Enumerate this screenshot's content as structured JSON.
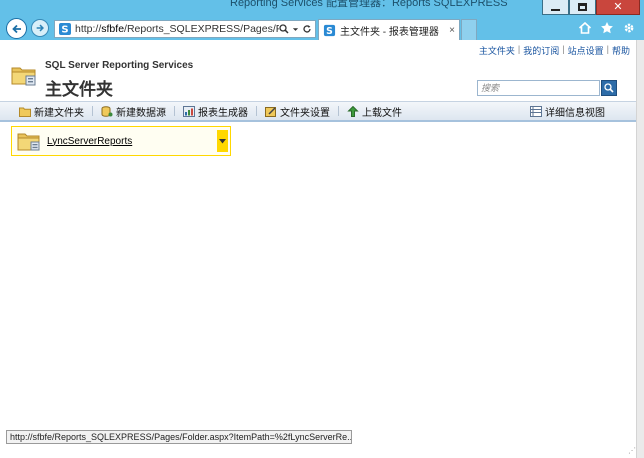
{
  "browser": {
    "window_title_fragment": "Reporting Services 配置管理器：Reports SQLEXPRESS",
    "address": {
      "url_prefix": "http://",
      "url_host": "sfbfe",
      "url_rest": "/Reports_SQLEXPRESS/Pages/Folder.asp"
    },
    "tab": {
      "label": "主文件夹 - 报表管理器",
      "close": "×"
    },
    "status_url": "http://sfbfe/Reports_SQLEXPRESS/Pages/Folder.aspx?ItemPath=%2fLyncServerRe..."
  },
  "top_links": [
    "主文件夹",
    "我的订阅",
    "站点设置",
    "帮助"
  ],
  "top_links_sep": "|",
  "header": {
    "brand": "SQL Server Reporting Services",
    "title": "主文件夹"
  },
  "search": {
    "placeholder": "搜索"
  },
  "toolbar": {
    "new_folder": "新建文件夹",
    "new_datasource": "新建数据源",
    "report_builder": "报表生成器",
    "folder_settings": "文件夹设置",
    "upload": "上载文件",
    "details_view": "详细信息视图"
  },
  "items": [
    {
      "name": "LyncServerReports"
    }
  ],
  "colors": {
    "chrome": "#63c0e8",
    "accent": "#1a55a0",
    "tile_highlight": "#ffd800",
    "close_button": "#c9463d"
  },
  "icons": [
    "back-icon",
    "forward-icon",
    "ie-site-icon",
    "search-icon",
    "refresh-icon",
    "home-icon",
    "star-icon",
    "gear-icon",
    "folder-icon"
  ]
}
